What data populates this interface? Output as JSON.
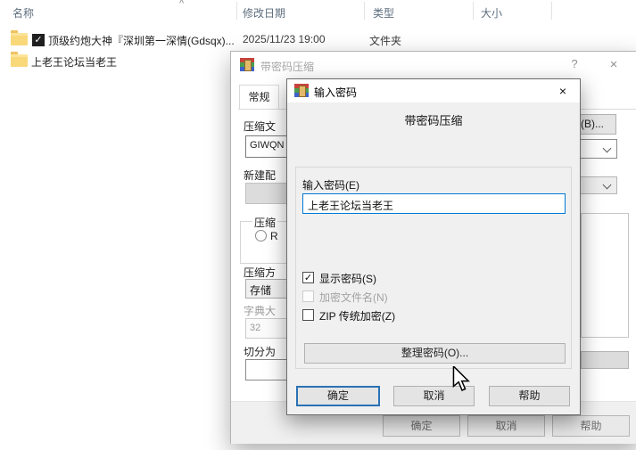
{
  "explorer": {
    "columns": {
      "name": "名称",
      "date": "修改日期",
      "type": "类型",
      "size": "大小"
    },
    "rows": [
      {
        "name": "顶级约炮大神『深圳第一深情(Gdsqx)...",
        "date": "2025/11/23 19:00",
        "type": "文件夹"
      },
      {
        "name": "上老王论坛当老王"
      }
    ]
  },
  "outer_dialog": {
    "title": "带密码压缩",
    "help_glyph": "?",
    "close_glyph": "×",
    "tab_general": "常规",
    "archive_name_label": "压缩文",
    "archive_name_value": "GIWQN",
    "profile_label": "新建配",
    "format_group_label": "压缩",
    "format_radio_label": "R",
    "method_label": "压缩方",
    "method_value": "存储",
    "dictionary_label": "字典大",
    "dictionary_value": "32",
    "split_label": "切分为",
    "browse_button_label": "(B)...",
    "ok_label": "确定",
    "cancel_label": "取消",
    "help_label": "帮助"
  },
  "password_dialog": {
    "title": "输入密码",
    "close_glyph": "×",
    "heading": "带密码压缩",
    "password_label": "输入密码(E)",
    "password_value": "上老王论坛当老王",
    "show_password_label": "显示密码(S)",
    "encrypt_names_label": "加密文件名(N)",
    "zip_legacy_label": "ZIP 传统加密(Z)",
    "organize_button_label": "整理密码(O)...",
    "ok_label": "确定",
    "cancel_label": "取消",
    "help_label": "帮助"
  },
  "icons": {
    "check": "✓",
    "sort_ascending": "^"
  },
  "colors": {
    "accent": "#0078d7",
    "folder": "#f8d878",
    "inactive_title": "#a6a6a6"
  }
}
